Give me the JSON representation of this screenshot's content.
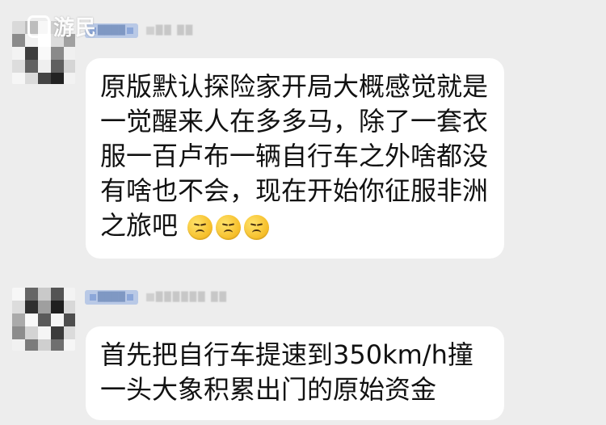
{
  "watermark": {
    "text": "游民"
  },
  "messages": [
    {
      "sender": {
        "name_badge": "████",
        "nickname": "██ ██"
      },
      "lines": [
        "原版默认探险家开局大概感觉就是",
        "一觉醒来人在多多马，除了一套衣",
        "服一百卢布一辆自行车之外啥都没",
        "有啥也不会，现在开始你征服非洲",
        "之旅吧"
      ],
      "emoji_count": 3
    },
    {
      "sender": {
        "name_badge": "████",
        "nickname": "██████ ██"
      },
      "lines": [
        "首先把自行车提速到350km/h撞",
        "一头大象积累出门的原始资金"
      ]
    }
  ]
}
